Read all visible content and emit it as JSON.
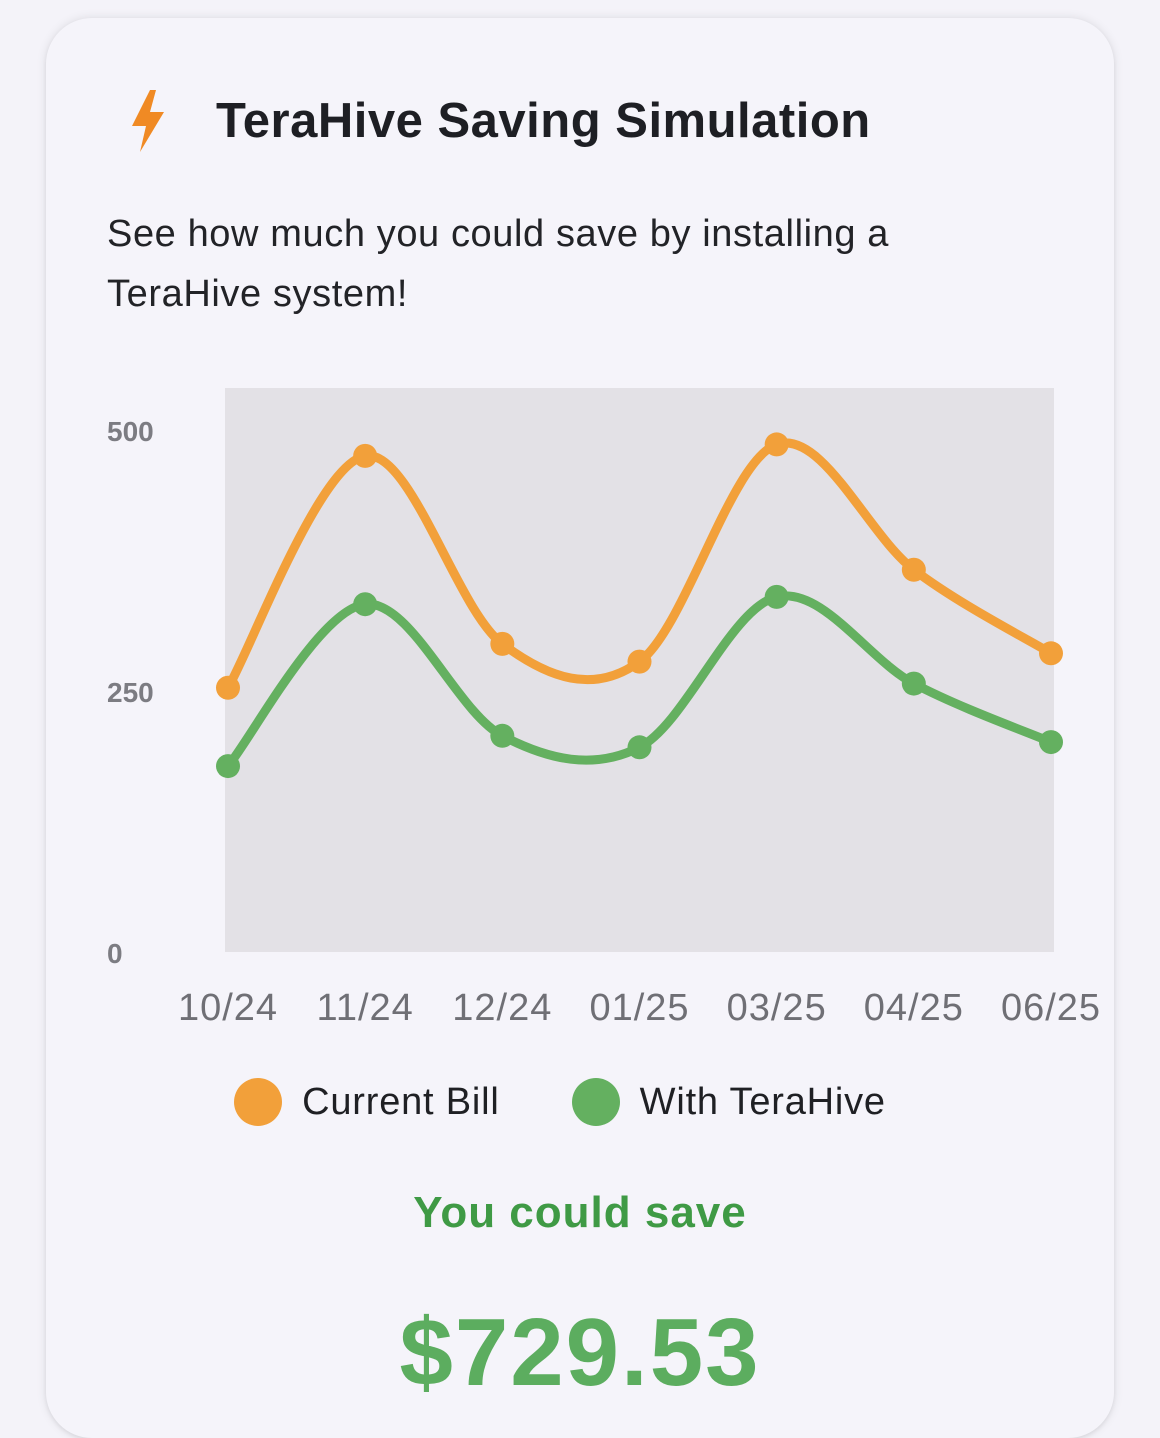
{
  "card": {
    "title": "TeraHive Saving Simulation",
    "subtitle": "See how much you could save by installing a TeraHive system!",
    "icon": "bolt-icon",
    "accent_color": "#f08a24",
    "savings_label": "You could save",
    "savings_amount": "$729.53"
  },
  "chart_data": {
    "type": "line",
    "categories": [
      "10/24",
      "11/24",
      "12/24",
      "01/25",
      "03/25",
      "04/25",
      "06/25"
    ],
    "ylim": [
      0,
      540
    ],
    "yticks": [
      0,
      250,
      500
    ],
    "grid": false,
    "legend_position": "bottom",
    "plot_background": "#e3e1e6",
    "series": [
      {
        "name": "Current Bill",
        "color": "#f2a03a",
        "values": [
          253,
          475,
          295,
          278,
          486,
          366,
          286
        ]
      },
      {
        "name": "With TeraHive",
        "color": "#64b060",
        "values": [
          178,
          333,
          207,
          196,
          340,
          257,
          201
        ]
      }
    ]
  }
}
